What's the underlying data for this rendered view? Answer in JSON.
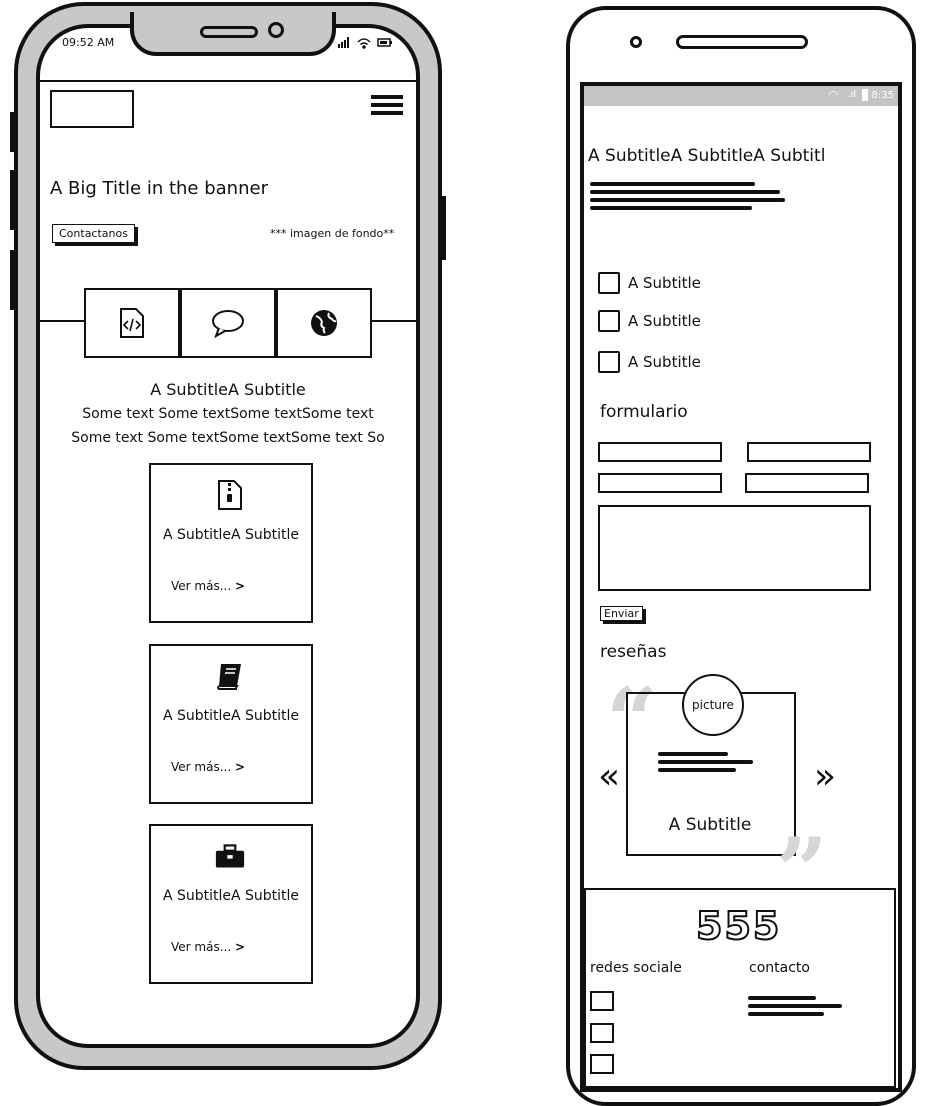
{
  "phone1": {
    "status": {
      "time": "09:52 AM",
      "icons": "signal-wifi-battery"
    },
    "header": {
      "logo": "logo-placeholder",
      "menu_icon": "hamburger-icon"
    },
    "banner": {
      "title": "A Big Title in the banner",
      "button_label": "Contactanos",
      "background_note": "*** imagen de fondo**"
    },
    "tabs": [
      {
        "icon": "code-file-icon"
      },
      {
        "icon": "chat-bubble-icon"
      },
      {
        "icon": "globe-icon"
      }
    ],
    "intro": {
      "subtitle": "A SubtitleA Subtitle",
      "line1": "Some text Some textSome textSome text",
      "line2": "Some text Some textSome textSome text So"
    },
    "cards": [
      {
        "icon": "zip-file-icon",
        "title": "A SubtitleA Subtitle",
        "link": "Ver más..."
      },
      {
        "icon": "book-icon",
        "title": "A SubtitleA Subtitle",
        "link": "Ver más..."
      },
      {
        "icon": "briefcase-icon",
        "title": "A SubtitleA Subtitle",
        "link": "Ver más..."
      }
    ]
  },
  "phone2": {
    "status": {
      "time": "8:35"
    },
    "heading": "A SubtitleA SubtitleA Subtitl",
    "checkboxes": [
      {
        "label": "A Subtitle"
      },
      {
        "label": "A Subtitle"
      },
      {
        "label": "A Subtitle"
      }
    ],
    "form": {
      "title": "formulario",
      "submit_label": "Enviar"
    },
    "reviews": {
      "title": "reseñas",
      "picture_label": "picture",
      "card_title": "A Subtitle",
      "prev": "«",
      "next": "»"
    },
    "footer": {
      "numbers": "555",
      "social_title": "redes sociale",
      "contact_title": "contacto"
    }
  }
}
